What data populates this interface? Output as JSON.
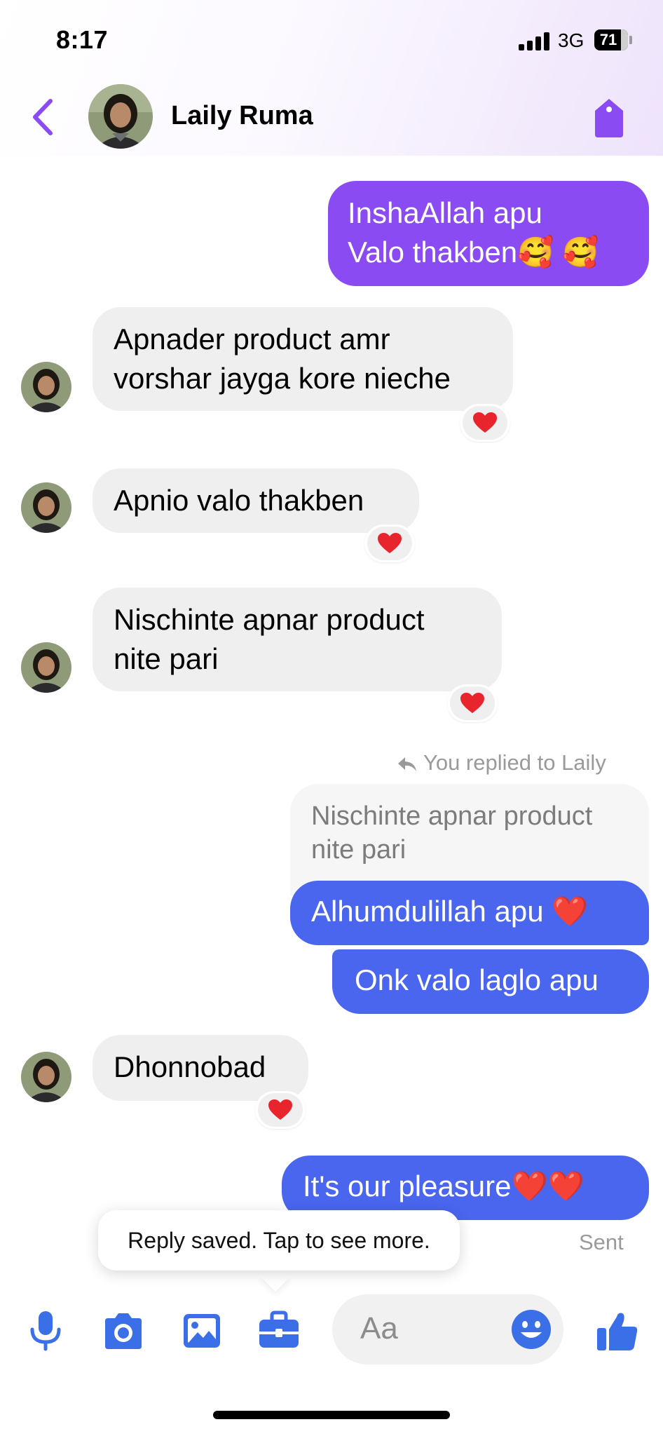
{
  "status_bar": {
    "time": "8:17",
    "network": "3G",
    "battery": "71"
  },
  "header": {
    "contact_name": "Laily Ruma",
    "back_icon": "chevron-left-icon",
    "action_icon": "tag-icon"
  },
  "messages": [
    {
      "from": "me",
      "lines": [
        "InshaAllah apu",
        "Valo thakben🥰 🥰"
      ]
    },
    {
      "from": "contact",
      "lines": [
        "Apnader product amr",
        "vorshar jayga kore nieche"
      ],
      "reaction": "❤️"
    },
    {
      "from": "contact",
      "lines": [
        "Apnio valo thakben"
      ],
      "reaction": "❤️"
    },
    {
      "from": "contact",
      "lines": [
        "Nischinte apnar product",
        "nite pari"
      ],
      "reaction": "❤️"
    },
    {
      "from": "me",
      "reply_note": "You replied to Laily",
      "quoted": "Nischinte apnar product nite pari",
      "lines": [
        "Alhumdulillah apu ❤️"
      ]
    },
    {
      "from": "me",
      "lines": [
        "Onk valo laglo apu"
      ]
    },
    {
      "from": "contact",
      "lines": [
        "Dhonnobad"
      ],
      "reaction": "❤️"
    },
    {
      "from": "me",
      "lines": [
        "It's our pleasure❤️❤️"
      ],
      "status": "Sent"
    }
  ],
  "tooltip": "Reply saved. Tap to see more.",
  "composer": {
    "placeholder": "Aa",
    "icons": [
      "microphone-icon",
      "camera-icon",
      "gallery-icon",
      "briefcase-icon",
      "emoji-icon",
      "thumbs-up-icon"
    ]
  },
  "colors": {
    "accent_purple": "#8a4bf2",
    "outgoing_blue": "#4a66ef",
    "incoming_bubble": "#efefef",
    "icon_blue": "#3b6fe8"
  }
}
